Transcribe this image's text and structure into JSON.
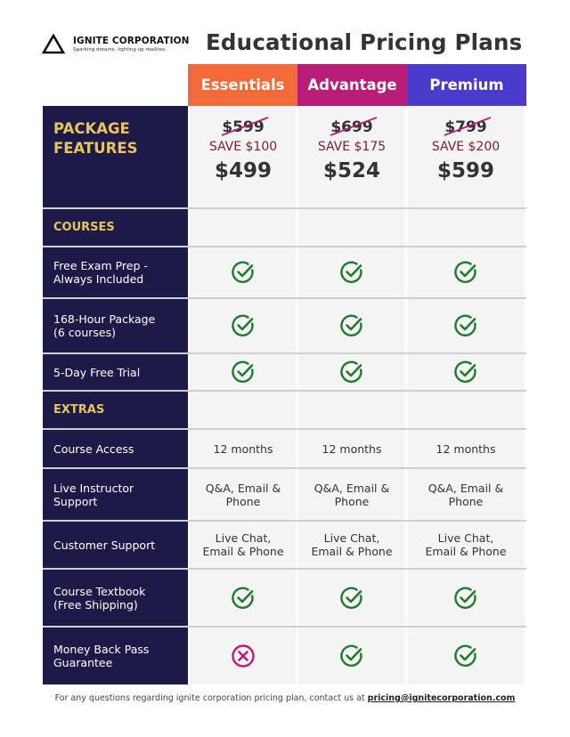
{
  "brand": {
    "name": "IGNITE CORPORATION",
    "tagline": "Sparking dreams, lighting up realities.",
    "icon": "triangle-logo-icon"
  },
  "title": "Educational Pricing Plans",
  "colors": {
    "essentials": "#f26a37",
    "advantage": "#b81d78",
    "premium": "#4a3bcc",
    "sidebar": "#1e1a48",
    "section_label": "#e8c55c",
    "check": "#217a2f",
    "cross": "#b81d78",
    "strike": "#b81d78"
  },
  "plans": [
    {
      "name": "Essentials",
      "old_price": "$599",
      "save": "SAVE $100",
      "price": "$499"
    },
    {
      "name": "Advantage",
      "old_price": "$699",
      "save": "SAVE $175",
      "price": "$524"
    },
    {
      "name": "Premium",
      "old_price": "$799",
      "save": "SAVE $200",
      "price": "$599"
    }
  ],
  "table": {
    "header_label": "PACKAGE FEATURES",
    "rows": [
      {
        "type": "section",
        "label": "COURSES"
      },
      {
        "type": "feature",
        "label": "Free Exam Prep - Always Included",
        "values": [
          "check",
          "check",
          "check"
        ]
      },
      {
        "type": "feature",
        "label": "168-Hour Package (6 courses)",
        "values": [
          "check",
          "check",
          "check"
        ]
      },
      {
        "type": "feature",
        "label": "5-Day Free Trial",
        "values": [
          "check",
          "check",
          "check"
        ]
      },
      {
        "type": "section",
        "label": "EXTRAS"
      },
      {
        "type": "feature",
        "label": "Course Access",
        "values": [
          "12 months",
          "12 months",
          "12 months"
        ]
      },
      {
        "type": "feature",
        "label": "Live Instructor Support",
        "values": [
          "Q&A, Email & Phone",
          "Q&A, Email & Phone",
          "Q&A, Email & Phone"
        ]
      },
      {
        "type": "feature",
        "label": "Customer Support",
        "values": [
          "Live Chat, Email & Phone",
          "Live Chat, Email & Phone",
          "Live Chat, Email & Phone"
        ]
      },
      {
        "type": "feature",
        "label": "Course Textbook (Free Shipping)",
        "values": [
          "check",
          "check",
          "check"
        ]
      },
      {
        "type": "feature",
        "label": "Money Back Pass Guarantee",
        "values": [
          "cross",
          "check",
          "check"
        ]
      }
    ]
  },
  "footer": {
    "text": "For any questions regarding ignite corporation pricing plan, contact us at ",
    "email": "pricing@ignitecorporation.com"
  }
}
